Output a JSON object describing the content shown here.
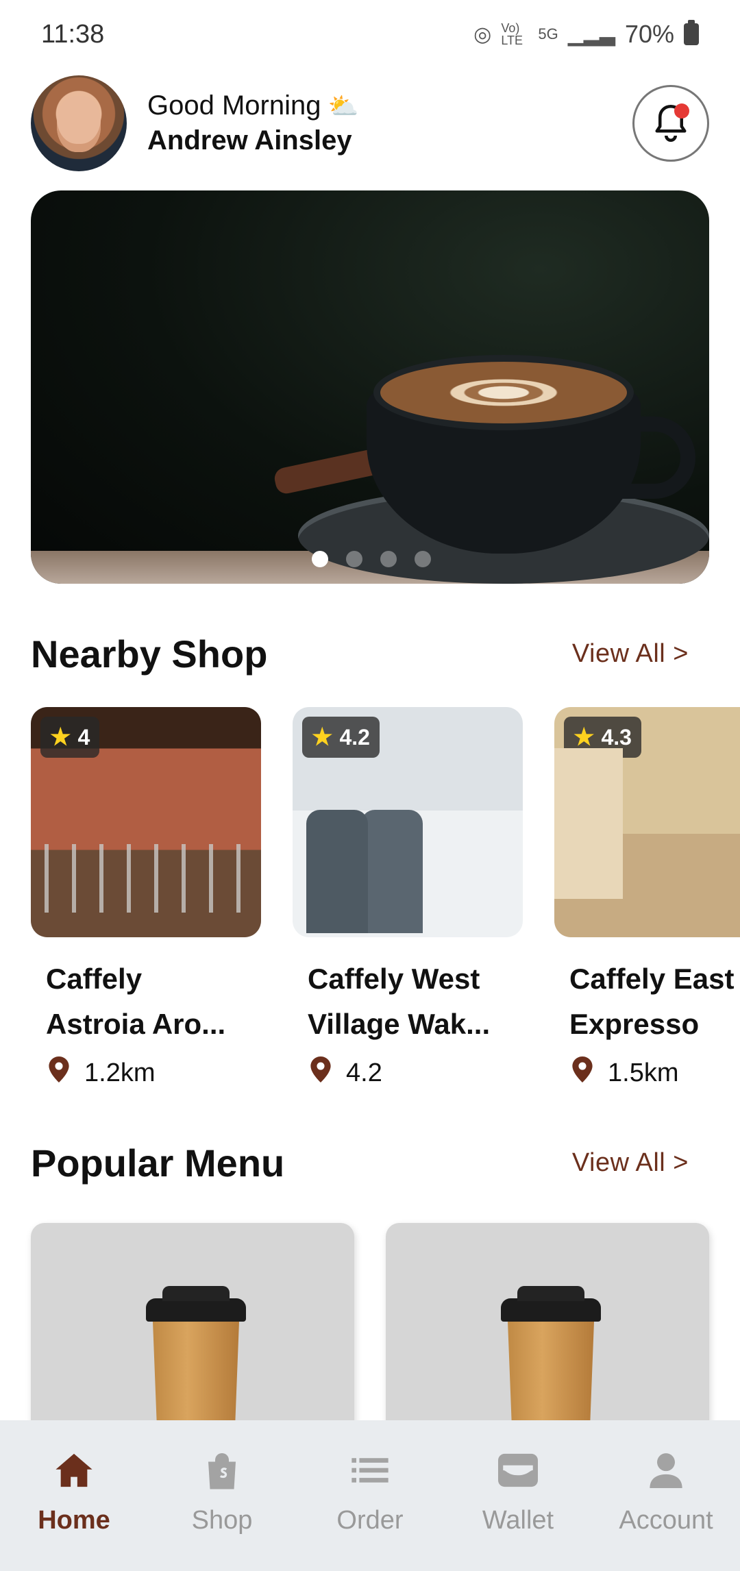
{
  "status_bar": {
    "time": "11:38",
    "battery": "70%",
    "signal_labels": [
      "Vo) LTE",
      "5G"
    ]
  },
  "header": {
    "greeting": "Good Morning",
    "weather_icon": "partly-cloudy-icon",
    "user_name": "Andrew Ainsley",
    "avatar": "user-avatar",
    "notification_icon": "bell-icon"
  },
  "banner": {
    "image": "latte-cup-photo",
    "slide_count": 4,
    "active_slide": 1
  },
  "nearby": {
    "title": "Nearby Shop",
    "view_all": "View All  >",
    "shops": [
      {
        "rating": "4",
        "name": "Caffely\nAstroia Aro...",
        "distance": "1.2km"
      },
      {
        "rating": "4.2",
        "name": "Caffely West\nVillage Wak...",
        "distance": "4.2"
      },
      {
        "rating": "4.3",
        "name": "Caffely East\nExpresso",
        "distance": "1.5km"
      }
    ]
  },
  "popular": {
    "title": "Popular Menu",
    "view_all": "View All  >"
  },
  "nav": {
    "items": [
      {
        "label": "Home",
        "icon": "home-icon",
        "active": true
      },
      {
        "label": "Shop",
        "icon": "shopping-bag-icon",
        "active": false
      },
      {
        "label": "Order",
        "icon": "list-icon",
        "active": false
      },
      {
        "label": "Wallet",
        "icon": "wallet-icon",
        "active": false
      },
      {
        "label": "Account",
        "icon": "person-icon",
        "active": false
      }
    ]
  },
  "colors": {
    "accent": "#6b2f1c",
    "nav_background": "#e9ecef",
    "star": "#ffd21f",
    "notification_dot": "#e53935"
  }
}
